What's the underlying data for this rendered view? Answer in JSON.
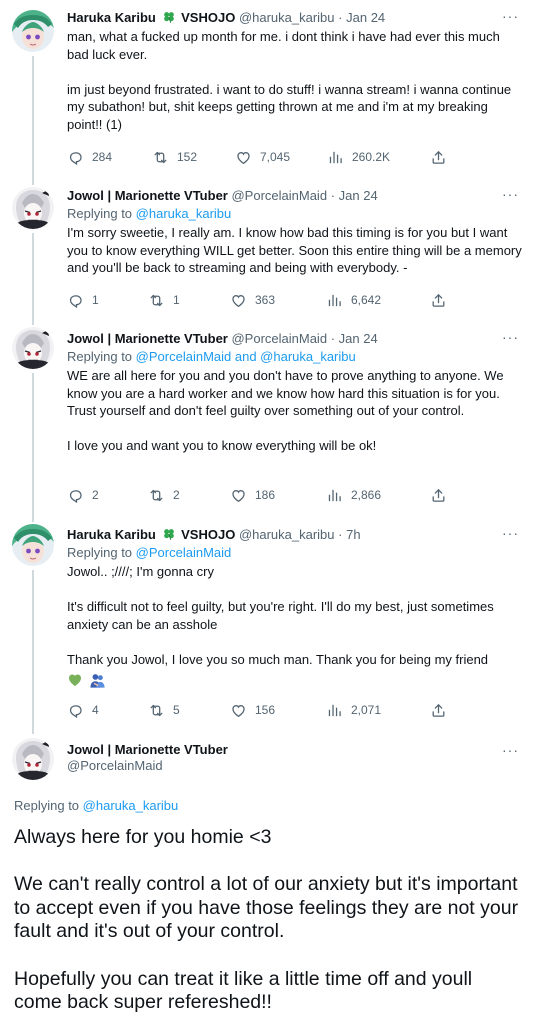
{
  "tweets": [
    {
      "name": "Haruka Karibu",
      "badge_icon": "four-leaf-clover-icon",
      "badge_text": "VSHOJO",
      "handle": "@haruka_karibu",
      "separator": "·",
      "time": "Jan 24",
      "more": "···",
      "paragraphs": [
        "man, what a fucked up month for me. i dont think i have had ever this much bad luck ever.",
        "im just beyond frustrated. i want to do stuff! i wanna stream! i wanna continue my subathon! but, shit keeps getting thrown at me and i'm at my breaking point!! (1)"
      ],
      "replies": "284",
      "retweets": "152",
      "likes": "7,045",
      "views": "260.2K"
    },
    {
      "name": "Jowol | Marionette VTuber",
      "handle": "@PorcelainMaid",
      "separator": "·",
      "time": "Jan 24",
      "more": "···",
      "replying_prefix": "Replying to",
      "replying_to": "@haruka_karibu",
      "paragraphs": [
        "I'm sorry sweetie, I really am. I know how bad this timing is for you but I want you to know everything WILL get better. Soon this entire thing will be a memory and you'll be back to streaming and being with everybody. -"
      ],
      "replies": "1",
      "retweets": "1",
      "likes": "363",
      "views": "6,642"
    },
    {
      "name": "Jowol | Marionette VTuber",
      "handle": "@PorcelainMaid",
      "separator": "·",
      "time": "Jan 24",
      "more": "···",
      "replying_prefix": "Replying to",
      "replying_to": "@PorcelainMaid and @haruka_karibu",
      "paragraphs": [
        "WE are all here for you and you don't have to prove anything to anyone. We know you are a hard worker and we know how hard this situation is for you. Trust yourself and don't feel guilty over something out of your control.",
        "I love you and want you to know everything will be ok!"
      ],
      "replies": "2",
      "retweets": "2",
      "likes": "186",
      "views": "2,866"
    },
    {
      "name": "Haruka Karibu",
      "badge_icon": "four-leaf-clover-icon",
      "badge_text": "VSHOJO",
      "handle": "@haruka_karibu",
      "separator": "·",
      "time": "7h",
      "more": "···",
      "replying_prefix": "Replying to",
      "replying_to": "@PorcelainMaid",
      "paragraphs": [
        "Jowol.. ;////; I'm gonna cry",
        "It's difficult not to feel guilty, but you're right. I'll do my best, just sometimes anxiety can be an asshole",
        "Thank you Jowol, I love you so much man. Thank you for being my friend"
      ],
      "emoji": [
        "green-heart-icon",
        "people-hugging-icon"
      ],
      "replies": "4",
      "retweets": "5",
      "likes": "156",
      "views": "2,071"
    }
  ],
  "focused": {
    "name": "Jowol | Marionette VTuber",
    "handle": "@PorcelainMaid",
    "more": "···",
    "replying_prefix": "Replying to",
    "replying_to": "@haruka_karibu",
    "paragraphs": [
      "Always here for you homie <3",
      "We can't really control a lot of our anxiety but it's important to accept even if you have those feelings they are not your fault and it's out of your control.",
      "Hopefully you can treat it like a little time off and youll come back super refereshed!!"
    ]
  },
  "colors": {
    "link": "#1d9bf0",
    "secondary_text": "#536471",
    "thread_line": "#cfd9de",
    "clover": "#2fa84f"
  }
}
